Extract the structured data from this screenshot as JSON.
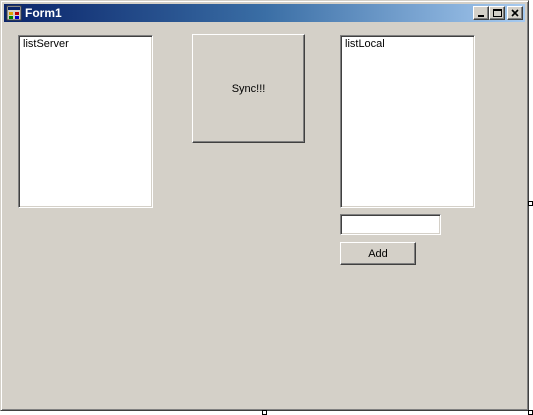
{
  "window": {
    "title": "Form1",
    "icon": "app-icon",
    "controls": {
      "minimize_icon": "minimize-icon",
      "maximize_icon": "maximize-icon",
      "close_icon": "close-icon"
    }
  },
  "server_list": {
    "items": [
      "listServer"
    ]
  },
  "sync_button": {
    "label": "Sync!!!"
  },
  "local_list": {
    "items": [
      "listLocal"
    ]
  },
  "add_input": {
    "value": ""
  },
  "add_button": {
    "label": "Add"
  },
  "colors": {
    "form_background": "#d4d0c8",
    "title_gradient_start": "#0a246a",
    "title_gradient_end": "#a6caf0"
  }
}
